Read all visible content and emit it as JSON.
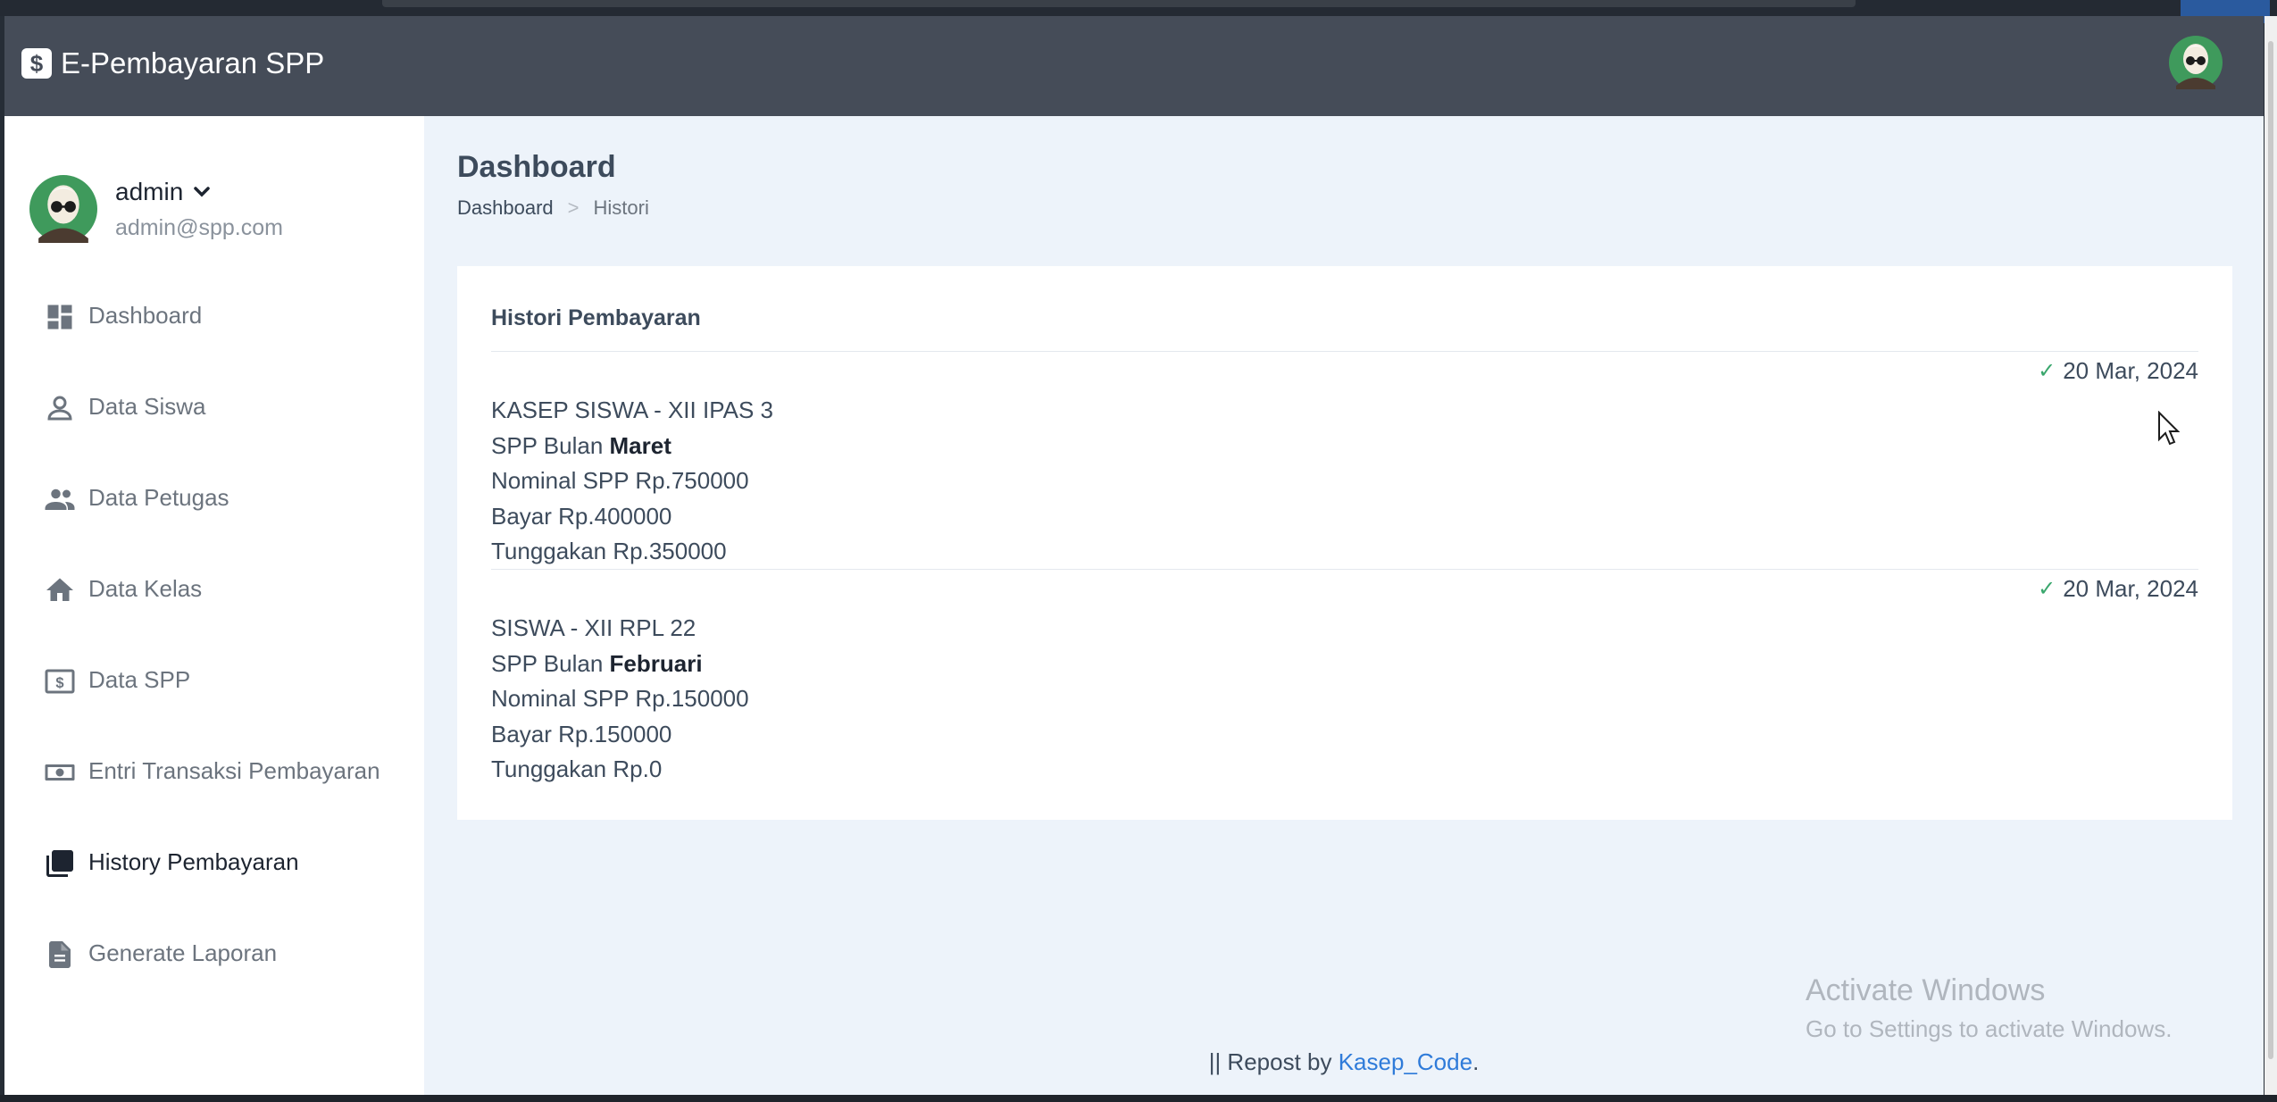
{
  "app": {
    "title": "E-Pembayaran SPP",
    "brand_icon": "dollar-icon"
  },
  "user": {
    "name": "admin",
    "email": "admin@spp.com"
  },
  "sidebar": {
    "items": [
      {
        "label": "Dashboard",
        "icon": "dashboard-icon"
      },
      {
        "label": "Data Siswa",
        "icon": "user-icon"
      },
      {
        "label": "Data Petugas",
        "icon": "users-icon"
      },
      {
        "label": "Data Kelas",
        "icon": "home-icon"
      },
      {
        "label": "Data SPP",
        "icon": "money-icon"
      },
      {
        "label": "Entri Transaksi Pembayaran",
        "icon": "cash-icon"
      },
      {
        "label": "History Pembayaran",
        "icon": "history-icon"
      },
      {
        "label": "Generate Laporan",
        "icon": "document-icon"
      }
    ],
    "active": "History Pembayaran"
  },
  "page": {
    "title": "Dashboard",
    "breadcrumb": [
      "Dashboard",
      "Histori"
    ]
  },
  "card": {
    "title": "Histori Pembayaran",
    "entries": [
      {
        "date": "20 Mar, 2024",
        "student": "KASEP SISWA - XII IPAS 3",
        "month_prefix": "SPP Bulan",
        "month": "Maret",
        "nominal": "Nominal SPP Rp.750000",
        "bayar": "Bayar Rp.400000",
        "tunggakan": "Tunggakan Rp.350000"
      },
      {
        "date": "20 Mar, 2024",
        "student": "SISWA - XII RPL 22",
        "month_prefix": "SPP Bulan",
        "month": "Februari",
        "nominal": "Nominal SPP Rp.150000",
        "bayar": "Bayar Rp.150000",
        "tunggakan": "Tunggakan Rp.0"
      }
    ]
  },
  "footer": {
    "prefix": "|| Repost by",
    "link": "Kasep_Code",
    "suffix": "."
  },
  "watermark": {
    "line1": "Activate Windows",
    "line2": "Go to Settings to activate Windows."
  },
  "colors": {
    "navbar": "#454c58",
    "background": "#edf3fa",
    "check": "#3aa76d",
    "link": "#2f7bd9"
  }
}
